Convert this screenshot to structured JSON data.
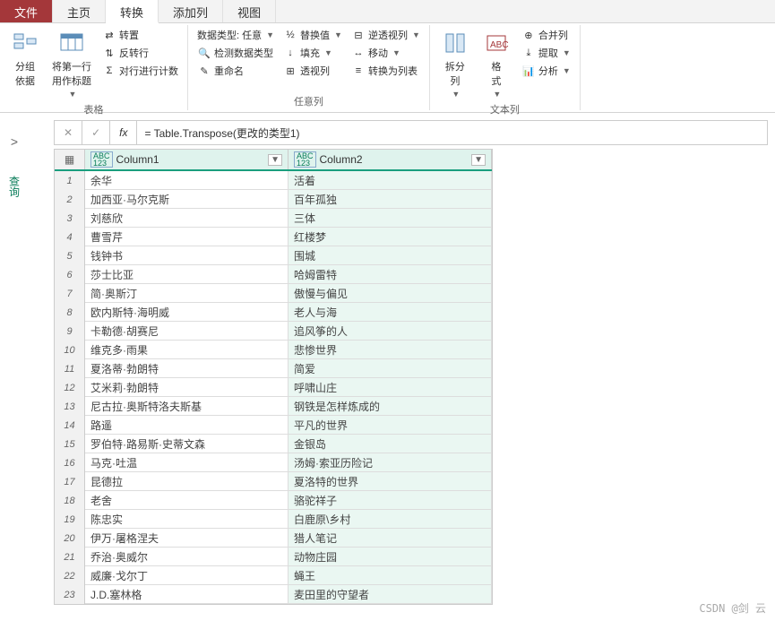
{
  "tabs": {
    "file": "文件",
    "home": "主页",
    "transform": "转换",
    "addcol": "添加列",
    "view": "视图"
  },
  "ribbon": {
    "groupby": "分组\n依据",
    "useheaders": "将第一行\n用作标题",
    "transpose": "转置",
    "reverse": "反转行",
    "countrows": "对行进行计数",
    "group_table": "表格",
    "datatype": "数据类型: 任意",
    "detect": "检测数据类型",
    "rename": "重命名",
    "replace": "替换值",
    "fill": "填充",
    "pivot": "透视列",
    "unpivot": "逆透视列",
    "move": "移动",
    "tolist": "转换为列表",
    "group_anycol": "任意列",
    "splitcol": "拆分\n列",
    "format": "格\n式",
    "merge": "合并列",
    "extract": "提取",
    "analyze": "分析",
    "group_textcol": "文本列"
  },
  "fx": {
    "cancel": "✕",
    "confirm": "✓",
    "fx": "fx",
    "formula": "= Table.Transpose(更改的类型1)"
  },
  "side": {
    "chevron": ">",
    "label": "查询"
  },
  "columns": {
    "c1": "Column1",
    "c2": "Column2",
    "type": "ABC\n123"
  },
  "rows": [
    {
      "n": "1",
      "a": "余华",
      "b": "活着"
    },
    {
      "n": "2",
      "a": "加西亚·马尔克斯",
      "b": "百年孤独"
    },
    {
      "n": "3",
      "a": "刘慈欣",
      "b": "三体"
    },
    {
      "n": "4",
      "a": "曹雪芹",
      "b": "红楼梦"
    },
    {
      "n": "5",
      "a": "钱钟书",
      "b": "围城"
    },
    {
      "n": "6",
      "a": "莎士比亚",
      "b": "哈姆雷特"
    },
    {
      "n": "7",
      "a": "简·奥斯汀",
      "b": "傲慢与偏见"
    },
    {
      "n": "8",
      "a": "欧内斯特·海明威",
      "b": "老人与海"
    },
    {
      "n": "9",
      "a": "卡勒德·胡赛尼",
      "b": "追风筝的人"
    },
    {
      "n": "10",
      "a": "维克多·雨果",
      "b": "悲惨世界"
    },
    {
      "n": "11",
      "a": "夏洛蒂·勃朗特",
      "b": "简爱"
    },
    {
      "n": "12",
      "a": "艾米莉·勃朗特",
      "b": "呼啸山庄"
    },
    {
      "n": "13",
      "a": "尼古拉·奥斯特洛夫斯基",
      "b": "钢铁是怎样炼成的"
    },
    {
      "n": "14",
      "a": "路遥",
      "b": "平凡的世界"
    },
    {
      "n": "15",
      "a": "罗伯特·路易斯·史蒂文森",
      "b": "金银岛"
    },
    {
      "n": "16",
      "a": "马克·吐温",
      "b": "汤姆·索亚历险记"
    },
    {
      "n": "17",
      "a": "昆德拉",
      "b": "夏洛特的世界"
    },
    {
      "n": "18",
      "a": "老舍",
      "b": "骆驼祥子"
    },
    {
      "n": "19",
      "a": "陈忠实",
      "b": "白鹿原\\乡村"
    },
    {
      "n": "20",
      "a": "伊万·屠格涅夫",
      "b": "猎人笔记"
    },
    {
      "n": "21",
      "a": "乔治·奥威尔",
      "b": "动物庄园"
    },
    {
      "n": "22",
      "a": "威廉·戈尔丁",
      "b": "蝇王"
    },
    {
      "n": "23",
      "a": "J.D.塞林格",
      "b": "麦田里的守望者"
    }
  ],
  "watermark": "CSDN @剑 云"
}
